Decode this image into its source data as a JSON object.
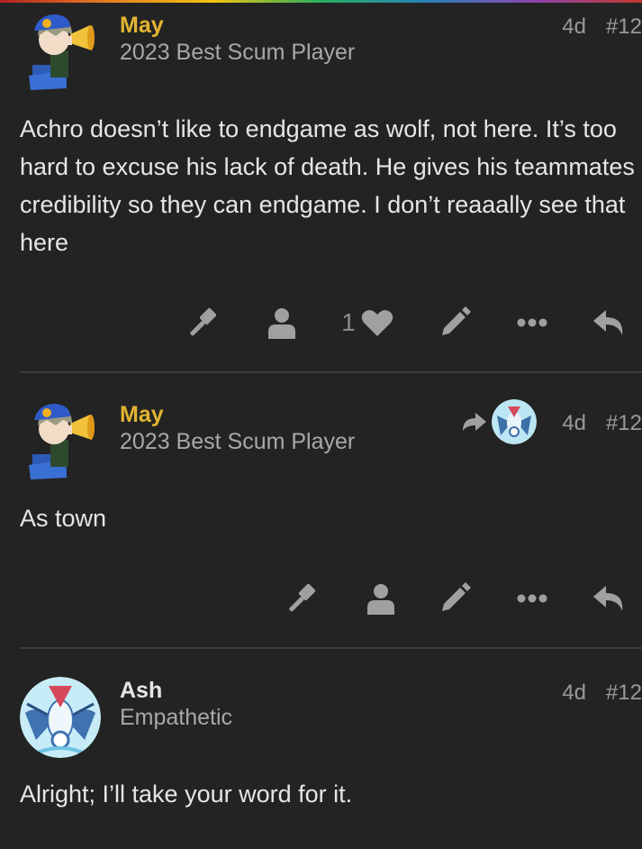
{
  "posts": [
    {
      "username": "May",
      "title": "2023 Best Scum Player",
      "age": "4d",
      "number": "#12",
      "body": "Achro doesn’t like to endgame as wolf, not here. It’s too hard to excuse his lack of death. He gives his teammates credibility so they can endgame. I don’t reaaally see that here",
      "like_count": "1"
    },
    {
      "username": "May",
      "title": "2023 Best Scum Player",
      "age": "4d",
      "number": "#12",
      "body": "As town",
      "reply_to_icon": "share-arrow-icon"
    },
    {
      "username": "Ash",
      "title": "Empathetic",
      "age": "4d",
      "number": "#12",
      "body": "Alright; I’ll take your word for it."
    }
  ],
  "icons": [
    "gavel-icon",
    "user-icon",
    "heart-icon",
    "pencil-icon",
    "more-icon",
    "reply-icon"
  ],
  "colors": {
    "background": "#232323",
    "username_accent": "#e2b430",
    "muted": "#9a9a9a",
    "text": "#e6e6e6"
  }
}
